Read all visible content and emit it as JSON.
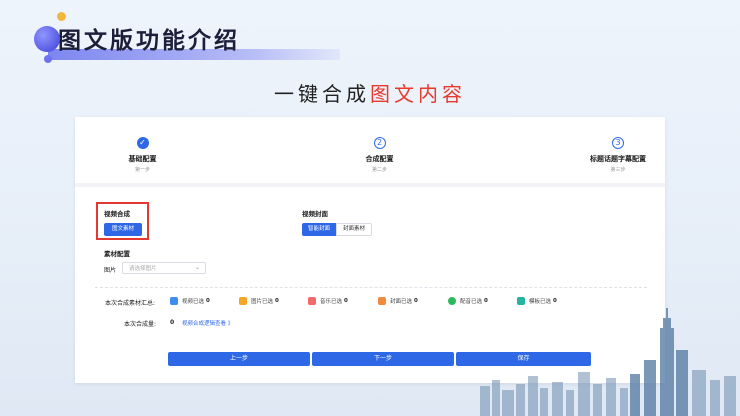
{
  "slide": {
    "title": "图文版功能介绍",
    "subtitle_plain": "一键合成",
    "subtitle_red": "图文内容"
  },
  "steps": [
    {
      "name": "基础配置",
      "sub": "第一步",
      "status": "done"
    },
    {
      "name": "合成配置",
      "sub": "第二步",
      "number": "2",
      "status": "todo"
    },
    {
      "name": "标题话题字幕配置",
      "sub": "第三步",
      "number": "3",
      "status": "todo"
    }
  ],
  "video_compose": {
    "label": "视频合成",
    "button": "图文素材"
  },
  "video_cover": {
    "label": "视频封面",
    "options": [
      "智能封面",
      "封面素材"
    ]
  },
  "material": {
    "label": "素材配置",
    "image_label": "图片",
    "image_placeholder": "请选择图片"
  },
  "summary": {
    "label": "本次合成素材汇总:",
    "items": [
      {
        "text": "视频已选",
        "count": "0",
        "color": "#3d8cf0"
      },
      {
        "text": "图片已选",
        "count": "0",
        "color": "#f5a623"
      },
      {
        "text": "音乐已选",
        "count": "0",
        "color": "#f06a6a"
      },
      {
        "text": "封面已选",
        "count": "0",
        "color": "#f08a3c"
      },
      {
        "text": "配音已选",
        "count": "0",
        "color": "#2eb85c"
      },
      {
        "text": "模板已选",
        "count": "0",
        "color": "#26b3a0"
      }
    ],
    "count_label": "本次合成量:",
    "count_value": "0",
    "link": "视频合成逻辑查看 》"
  },
  "buttons": {
    "prev": "上一步",
    "next": "下一步",
    "save": "保存"
  },
  "colors": {
    "accent": "#2f68e6",
    "highlight_red": "#e63a2e"
  }
}
